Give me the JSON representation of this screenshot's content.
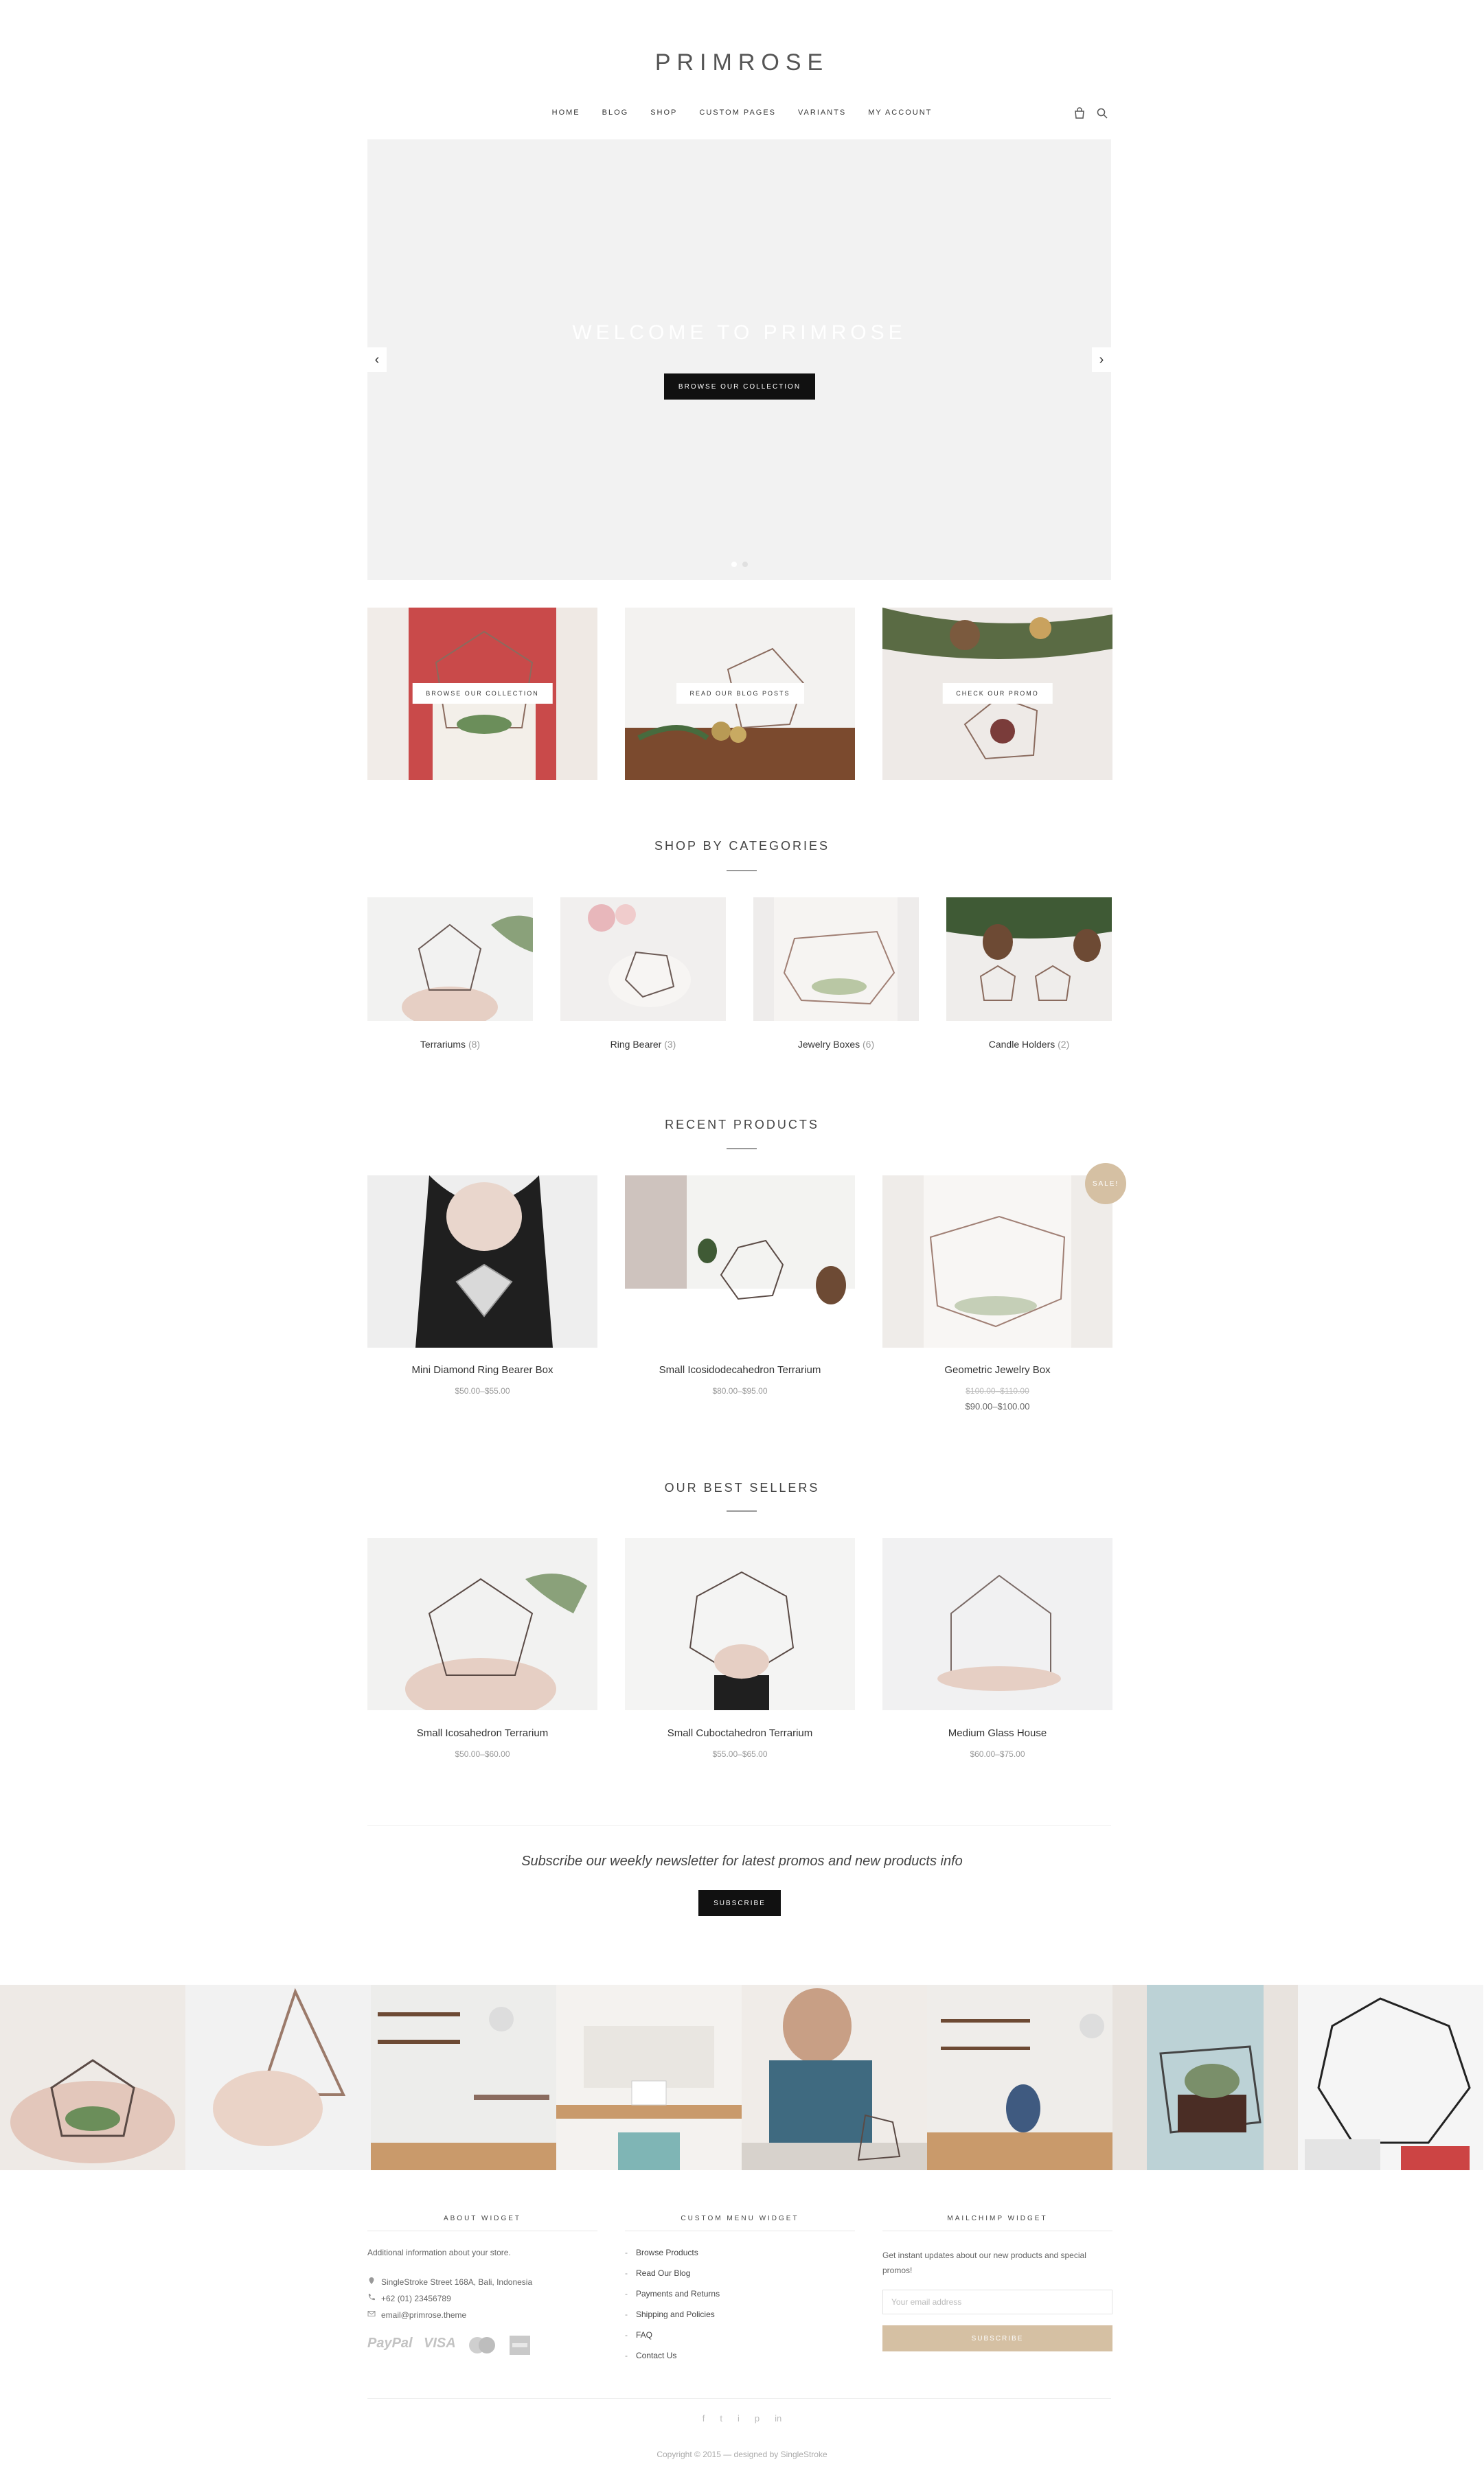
{
  "brand": {
    "logo": "PRIMROSE"
  },
  "nav": {
    "items": [
      "HOME",
      "BLOG",
      "SHOP",
      "CUSTOM PAGES",
      "VARIANTS",
      "MY ACCOUNT"
    ],
    "icons": [
      "bag-icon",
      "search-icon"
    ]
  },
  "hero": {
    "title": "WELCOME TO PRIMROSE",
    "button": "BROWSE OUR COLLECTION",
    "prev": "‹",
    "next": "›"
  },
  "promos": [
    {
      "label": "BROWSE OUR COLLECTION"
    },
    {
      "label": "READ OUR BLOG POSTS"
    },
    {
      "label": "CHECK OUR PROMO"
    }
  ],
  "categories": {
    "title": "SHOP BY CATEGORIES",
    "items": [
      {
        "name": "Terrariums",
        "count": "(8)"
      },
      {
        "name": "Ring Bearer",
        "count": "(3)"
      },
      {
        "name": "Jewelry Boxes",
        "count": "(6)"
      },
      {
        "name": "Candle Holders",
        "count": "(2)"
      }
    ]
  },
  "recent": {
    "title": "RECENT PRODUCTS",
    "items": [
      {
        "name": "Mini Diamond Ring Bearer Box",
        "price": "$50.00–$55.00"
      },
      {
        "name": "Small Icosidodecahedron Terrarium",
        "price": "$80.00–$95.00"
      },
      {
        "name": "Geometric Jewelry Box",
        "price_old": "$100.00–$110.00",
        "price": "$90.00–$100.00",
        "badge": "SALE!"
      }
    ]
  },
  "bestsellers": {
    "title": "OUR BEST SELLERS",
    "items": [
      {
        "name": "Small Icosahedron Terrarium",
        "price": "$50.00–$60.00"
      },
      {
        "name": "Small Cuboctahedron Terrarium",
        "price": "$55.00–$65.00"
      },
      {
        "name": "Medium Glass House",
        "price": "$60.00–$75.00"
      }
    ]
  },
  "newsletter": {
    "text": "Subscribe our weekly newsletter for latest promos and new products info",
    "button": "SUBSCRIBE"
  },
  "footer": {
    "about": {
      "title": "ABOUT WIDGET",
      "text": "Additional information about your store.",
      "address": "SingleStroke Street 168A, Bali, Indonesia",
      "phone": "+62 (01) 23456789",
      "email": "email@primrose.theme",
      "payments": [
        "PayPal",
        "VISA",
        "mastercard",
        "amex"
      ]
    },
    "menu": {
      "title": "CUSTOM MENU WIDGET",
      "items": [
        "Browse Products",
        "Read Our Blog",
        "Payments and Returns",
        "Shipping and Policies",
        "FAQ",
        "Contact Us"
      ]
    },
    "mailchimp": {
      "title": "MAILCHIMP WIDGET",
      "text": "Get instant updates about our new products and special promos!",
      "placeholder": "Your email address",
      "button": "SUBSCRIBE"
    },
    "social": [
      "f",
      "t",
      "i",
      "p",
      "in"
    ],
    "copyright": "Copyright © 2015 — designed by SingleStroke"
  },
  "colors": {
    "accent": "#d5c0a3",
    "dark_button": "#111111",
    "hero_bg": "#f2f2f2"
  }
}
